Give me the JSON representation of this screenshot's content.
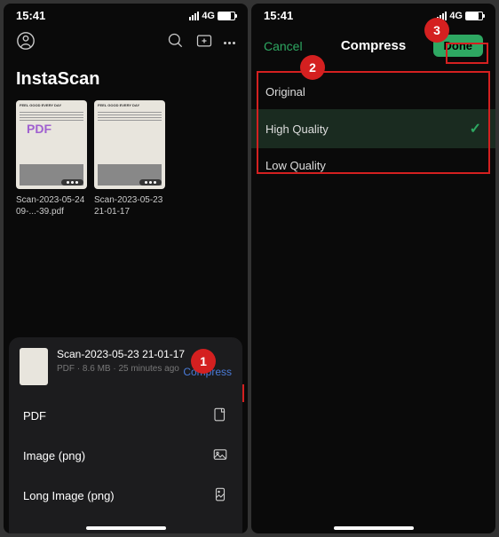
{
  "status": {
    "time": "15:41",
    "network": "4G"
  },
  "app_title": "InstaScan",
  "docs": [
    {
      "name": "Scan-2023-05-24 09-...-39.pdf",
      "overlay": "PDF",
      "header": "FEEL GOOD EVERY DAY"
    },
    {
      "name": "Scan-2023-05-23 21-01-17",
      "header": "FEEL GOOD EVERY DAY"
    }
  ],
  "sheet": {
    "title": "Scan-2023-05-23 21-01-17",
    "meta": "PDF · 8.6 MB · 25 minutes ago",
    "compress": "Compress",
    "options": [
      {
        "label": "PDF"
      },
      {
        "label": "Image (png)"
      },
      {
        "label": "Long Image (png)"
      }
    ]
  },
  "modal": {
    "cancel": "Cancel",
    "title": "Compress",
    "done": "Done",
    "options": [
      {
        "label": "Original",
        "selected": false
      },
      {
        "label": "High Quality",
        "selected": true
      },
      {
        "label": "Low Quality",
        "selected": false
      }
    ]
  },
  "annotations": {
    "b1": "1",
    "b2": "2",
    "b3": "3"
  }
}
